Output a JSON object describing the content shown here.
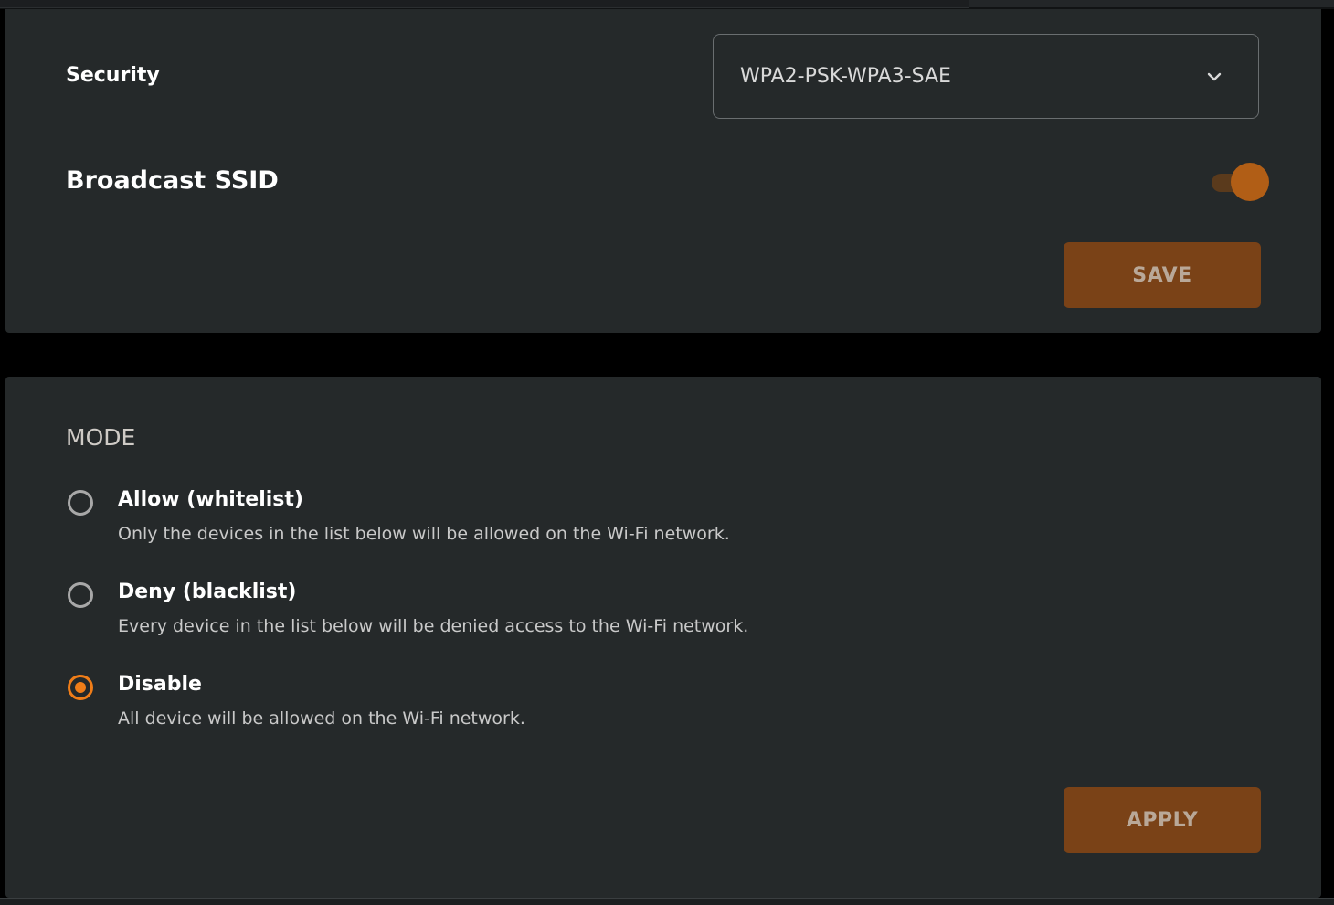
{
  "security": {
    "label": "Security",
    "selected_value": "WPA2-PSK-WPA3-SAE",
    "chevron_icon": "chevron-down-icon"
  },
  "broadcast_ssid": {
    "label": "Broadcast SSID",
    "enabled": true
  },
  "save_button": {
    "label": "SAVE"
  },
  "mode": {
    "heading": "MODE",
    "options": [
      {
        "title": "Allow (whitelist)",
        "description": "Only the devices in the list below will be allowed on the Wi-Fi network.",
        "selected": false
      },
      {
        "title": "Deny (blacklist)",
        "description": "Every device in the list below will be denied access to the Wi-Fi network.",
        "selected": false
      },
      {
        "title": "Disable",
        "description": "All device will be allowed on the Wi-Fi network.",
        "selected": true
      }
    ],
    "apply_label": "APPLY"
  },
  "colors": {
    "accent": "#f07d18",
    "button_bg": "#7a4217",
    "card_bg": "#25292a",
    "page_bg": "#000000"
  }
}
